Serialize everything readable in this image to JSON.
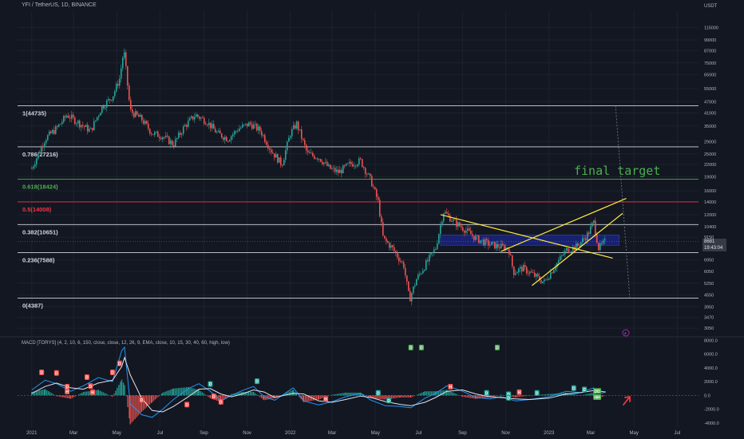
{
  "header": {
    "symbol_line": "YFI / TetherUS, 1D, BINANCE",
    "quote_currency": "USDT"
  },
  "indicator": {
    "label": "MACD [TORYS] (4, 2, 10, 6, 150, close, close, 12, 26, 9, EMA, close, 10, 15, 30, 40, 60, high, low)"
  },
  "annotation": {
    "final_target": "final target"
  },
  "live_price": {
    "price": "8681",
    "countdown": "19:43:04"
  },
  "colors": {
    "background": "#131722",
    "up": "#26a69a",
    "down": "#ef5350",
    "fib_white": "#d1d4dc",
    "fib_green": "#4caf50",
    "fib_red": "#f23645",
    "trend_yellow": "#ffeb3b",
    "zone_blue": "#1a237e",
    "macd_line": "#2196f3",
    "signal_line": "#e0e3eb"
  },
  "chart_data": [
    {
      "type": "candlestick",
      "title": "YFI / TetherUS, 1D, BINANCE",
      "y_scale": "log",
      "ylim": [
        2800,
        140000
      ],
      "y_ticks": [
        "115000",
        "99000",
        "87000",
        "75000",
        "65000",
        "55000",
        "47000",
        "41000",
        "35000",
        "29000",
        "25000",
        "22000",
        "19000",
        "16000",
        "14000",
        "12000",
        "10400",
        "9150",
        "8681",
        "6950",
        "6050",
        "5250",
        "4550",
        "3950",
        "3470",
        "3050"
      ],
      "x_ticks": [
        "2021",
        "Mar",
        "May",
        "Jul",
        "Sep",
        "Nov",
        "2022",
        "Mar",
        "May",
        "Jul",
        "Sep",
        "Nov",
        "2023",
        "Mar",
        "May",
        "Jul"
      ],
      "price_path": [
        [
          "2021-01-01",
          21000
        ],
        [
          "2021-01-20",
          30000
        ],
        [
          "2021-02-05",
          34000
        ],
        [
          "2021-02-20",
          40000
        ],
        [
          "2021-03-10",
          36000
        ],
        [
          "2021-03-25",
          33000
        ],
        [
          "2021-04-10",
          44000
        ],
        [
          "2021-04-25",
          50000
        ],
        [
          "2021-05-05",
          62000
        ],
        [
          "2021-05-11",
          88000
        ],
        [
          "2021-05-20",
          42000
        ],
        [
          "2021-06-05",
          38000
        ],
        [
          "2021-06-20",
          32000
        ],
        [
          "2021-07-05",
          31000
        ],
        [
          "2021-07-20",
          28000
        ],
        [
          "2021-08-05",
          35000
        ],
        [
          "2021-08-20",
          40000
        ],
        [
          "2021-09-05",
          37000
        ],
        [
          "2021-09-20",
          32000
        ],
        [
          "2021-10-05",
          30000
        ],
        [
          "2021-10-20",
          34000
        ],
        [
          "2021-11-05",
          36000
        ],
        [
          "2021-11-20",
          33000
        ],
        [
          "2021-12-05",
          26000
        ],
        [
          "2021-12-20",
          22000
        ],
        [
          "2022-01-01",
          32000
        ],
        [
          "2022-01-10",
          36000
        ],
        [
          "2022-01-25",
          25000
        ],
        [
          "2022-02-10",
          24000
        ],
        [
          "2022-02-25",
          21000
        ],
        [
          "2022-03-10",
          20000
        ],
        [
          "2022-03-25",
          22000
        ],
        [
          "2022-04-10",
          23000
        ],
        [
          "2022-04-25",
          18000
        ],
        [
          "2022-05-05",
          14000
        ],
        [
          "2022-05-12",
          9000
        ],
        [
          "2022-05-25",
          8000
        ],
        [
          "2022-06-10",
          6500
        ],
        [
          "2022-06-18",
          4300
        ],
        [
          "2022-06-28",
          5500
        ],
        [
          "2022-07-10",
          6500
        ],
        [
          "2022-07-25",
          8000
        ],
        [
          "2022-08-05",
          12500
        ],
        [
          "2022-08-20",
          11000
        ],
        [
          "2022-09-05",
          10000
        ],
        [
          "2022-09-20",
          9000
        ],
        [
          "2022-10-05",
          8500
        ],
        [
          "2022-10-20",
          8200
        ],
        [
          "2022-11-05",
          8000
        ],
        [
          "2022-11-12",
          6000
        ],
        [
          "2022-11-25",
          6300
        ],
        [
          "2022-12-10",
          5800
        ],
        [
          "2022-12-25",
          5300
        ],
        [
          "2023-01-10",
          6500
        ],
        [
          "2023-01-25",
          7800
        ],
        [
          "2023-02-10",
          8200
        ],
        [
          "2023-02-25",
          9500
        ],
        [
          "2023-03-05",
          11000
        ],
        [
          "2023-03-12",
          8000
        ],
        [
          "2023-03-22",
          8700
        ]
      ],
      "fib_levels": [
        {
          "label": "1(44735)",
          "value": 44735,
          "color": "#d1d4dc"
        },
        {
          "label": "0.786(27216)",
          "value": 27216,
          "color": "#d1d4dc"
        },
        {
          "label": "0.618(18424)",
          "value": 18424,
          "color": "#4caf50"
        },
        {
          "label": "0.5(14008)",
          "value": 14008,
          "color": "#f23645"
        },
        {
          "label": "0.382(10651)",
          "value": 10651,
          "color": "#d1d4dc"
        },
        {
          "label": "0.236(7588)",
          "value": 7588,
          "color": "#d1d4dc"
        },
        {
          "label": "0(4387)",
          "value": 4387,
          "color": "#d1d4dc"
        }
      ],
      "support_zone": {
        "from": "2022-08-01",
        "to": "2023-04-10",
        "low": 8300,
        "high": 9400
      },
      "trend_lines": [
        {
          "from": [
            "2022-08-01",
            12000
          ],
          "to": [
            "2023-04-01",
            7100
          ]
        },
        {
          "from": [
            "2022-12-08",
            5100
          ],
          "to": [
            "2023-04-15",
            12200
          ]
        },
        {
          "from": [
            "2022-10-25",
            7700
          ],
          "to": [
            "2023-04-20",
            14600
          ]
        }
      ],
      "projection_line": {
        "from": [
          "2023-04-05",
          44735
        ],
        "to": [
          "2023-04-25",
          4387
        ]
      },
      "price_label": "8681"
    },
    {
      "type": "line",
      "title": "MACD [TORYS] (4, 2, 10, 6, 150, close, close, 12, 26, 9, EMA, close, 10, 15, 30, 40, 60, high, low)",
      "ylim": [
        -4600,
        8400
      ],
      "y_ticks": [
        "8000.0",
        "6000.0",
        "4000.0",
        "2000.0",
        "0.0",
        "-2000.0",
        "-4000.0"
      ],
      "series": [
        {
          "values": [
            [
              "2021-01-01",
              800
            ],
            [
              "2021-01-20",
              2200
            ],
            [
              "2021-02-05",
              1700
            ],
            [
              "2021-02-25",
              600
            ],
            [
              "2021-03-15",
              1400
            ],
            [
              "2021-04-05",
              2600
            ],
            [
              "2021-04-25",
              2000
            ],
            [
              "2021-05-08",
              6500
            ],
            [
              "2021-05-12",
              7000
            ],
            [
              "2021-05-20",
              -1200
            ],
            [
              "2021-06-05",
              -2800
            ],
            [
              "2021-06-20",
              -3200
            ],
            [
              "2021-07-05",
              -2000
            ],
            [
              "2021-07-20",
              -600
            ],
            [
              "2021-08-10",
              1000
            ],
            [
              "2021-08-25",
              1700
            ],
            [
              "2021-09-10",
              600
            ],
            [
              "2021-09-25",
              -800
            ],
            [
              "2021-10-10",
              0
            ],
            [
              "2021-10-25",
              700
            ],
            [
              "2021-11-10",
              1300
            ],
            [
              "2021-11-25",
              -200
            ],
            [
              "2021-12-10",
              -700
            ],
            [
              "2022-01-05",
              1100
            ],
            [
              "2022-01-20",
              -800
            ],
            [
              "2022-02-10",
              -1400
            ],
            [
              "2022-03-01",
              -900
            ],
            [
              "2022-03-20",
              -200
            ],
            [
              "2022-04-10",
              300
            ],
            [
              "2022-04-25",
              -700
            ],
            [
              "2022-05-15",
              -1500
            ],
            [
              "2022-06-05",
              -1600
            ],
            [
              "2022-06-20",
              -1800
            ],
            [
              "2022-07-10",
              -400
            ],
            [
              "2022-07-25",
              300
            ],
            [
              "2022-08-10",
              1400
            ],
            [
              "2022-09-01",
              600
            ],
            [
              "2022-09-20",
              -300
            ],
            [
              "2022-10-10",
              -500
            ],
            [
              "2022-10-25",
              -200
            ],
            [
              "2022-11-15",
              -800
            ],
            [
              "2022-12-05",
              -600
            ],
            [
              "2023-01-01",
              -200
            ],
            [
              "2023-01-25",
              600
            ],
            [
              "2023-02-15",
              400
            ],
            [
              "2023-03-05",
              1100
            ],
            [
              "2023-03-15",
              300
            ],
            [
              "2023-03-22",
              500
            ]
          ]
        },
        {
          "values": [
            [
              "2021-01-01",
              300
            ],
            [
              "2021-01-20",
              1300
            ],
            [
              "2021-02-05",
              1800
            ],
            [
              "2021-02-25",
              1100
            ],
            [
              "2021-03-15",
              900
            ],
            [
              "2021-04-05",
              1800
            ],
            [
              "2021-04-25",
              2200
            ],
            [
              "2021-05-08",
              4200
            ],
            [
              "2021-05-12",
              5500
            ],
            [
              "2021-05-20",
              3000
            ],
            [
              "2021-06-05",
              -400
            ],
            [
              "2021-06-20",
              -2200
            ],
            [
              "2021-07-05",
              -2400
            ],
            [
              "2021-07-20",
              -1600
            ],
            [
              "2021-08-10",
              -200
            ],
            [
              "2021-08-25",
              900
            ],
            [
              "2021-09-10",
              1000
            ],
            [
              "2021-09-25",
              200
            ],
            [
              "2021-10-10",
              -200
            ],
            [
              "2021-10-25",
              200
            ],
            [
              "2021-11-10",
              800
            ],
            [
              "2021-11-25",
              500
            ],
            [
              "2021-12-10",
              -300
            ],
            [
              "2022-01-05",
              300
            ],
            [
              "2022-01-20",
              200
            ],
            [
              "2022-02-10",
              -800
            ],
            [
              "2022-03-01",
              -1000
            ],
            [
              "2022-03-20",
              -600
            ],
            [
              "2022-04-10",
              -100
            ],
            [
              "2022-04-25",
              -300
            ],
            [
              "2022-05-15",
              -900
            ],
            [
              "2022-06-05",
              -1300
            ],
            [
              "2022-06-20",
              -1500
            ],
            [
              "2022-07-10",
              -1000
            ],
            [
              "2022-07-25",
              -300
            ],
            [
              "2022-08-10",
              600
            ],
            [
              "2022-09-01",
              800
            ],
            [
              "2022-09-20",
              200
            ],
            [
              "2022-10-10",
              -200
            ],
            [
              "2022-10-25",
              -300
            ],
            [
              "2022-11-15",
              -500
            ],
            [
              "2022-12-05",
              -600
            ],
            [
              "2023-01-01",
              -400
            ],
            [
              "2023-01-25",
              200
            ],
            [
              "2023-02-15",
              400
            ],
            [
              "2023-03-05",
              700
            ],
            [
              "2023-03-15",
              600
            ],
            [
              "2023-03-22",
              500
            ]
          ]
        }
      ],
      "markers": [
        {
          "x": "2021-01-15",
          "y": 3300,
          "t": "D",
          "c": "#ef5350"
        },
        {
          "x": "2021-02-05",
          "y": 3200,
          "t": "D",
          "c": "#ef5350"
        },
        {
          "x": "2021-02-20",
          "y": 1200,
          "t": "D",
          "c": "#ef5350"
        },
        {
          "x": "2021-02-20",
          "y": 500,
          "t": "H",
          "c": "#ef5350"
        },
        {
          "x": "2021-03-20",
          "y": 2600,
          "t": "D",
          "c": "#ef5350"
        },
        {
          "x": "2021-03-25",
          "y": 1300,
          "t": "D",
          "c": "#ef5350"
        },
        {
          "x": "2021-03-28",
          "y": 400,
          "t": "H",
          "c": "#ef5350"
        },
        {
          "x": "2021-04-25",
          "y": 3300,
          "t": "D",
          "c": "#ef5350"
        },
        {
          "x": "2021-05-05",
          "y": 4600,
          "t": "D",
          "c": "#ef5350"
        },
        {
          "x": "2021-06-05",
          "y": -700,
          "t": "D",
          "c": "#ef5350"
        },
        {
          "x": "2021-08-08",
          "y": -1400,
          "t": "D",
          "c": "#ef5350"
        },
        {
          "x": "2021-09-10",
          "y": 1600,
          "t": "D",
          "c": "#26a69a"
        },
        {
          "x": "2021-09-15",
          "y": -200,
          "t": "D",
          "c": "#ef5350"
        },
        {
          "x": "2021-09-25",
          "y": -1000,
          "t": "D",
          "c": "#ef5350"
        },
        {
          "x": "2021-11-15",
          "y": 2000,
          "t": "D",
          "c": "#26a69a"
        },
        {
          "x": "2022-02-20",
          "y": -600,
          "t": "H",
          "c": "#ef5350"
        },
        {
          "x": "2022-05-05",
          "y": 300,
          "t": "D",
          "c": "#26a69a"
        },
        {
          "x": "2022-05-20",
          "y": -800,
          "t": "D",
          "c": "#26a69a"
        },
        {
          "x": "2022-06-20",
          "y": 6900,
          "t": "D",
          "c": "#4caf50"
        },
        {
          "x": "2022-07-05",
          "y": 6900,
          "t": "D",
          "c": "#4caf50"
        },
        {
          "x": "2022-08-15",
          "y": 1200,
          "t": "H",
          "c": "#ef5350"
        },
        {
          "x": "2022-10-20",
          "y": 6900,
          "t": "D",
          "c": "#4caf50"
        },
        {
          "x": "2022-10-05",
          "y": 300,
          "t": "D",
          "c": "#26a69a"
        },
        {
          "x": "2022-11-05",
          "y": 100,
          "t": "D",
          "c": "#26a69a"
        },
        {
          "x": "2022-11-05",
          "y": -400,
          "t": "D",
          "c": "#26a69a"
        },
        {
          "x": "2022-11-20",
          "y": 400,
          "t": "H",
          "c": "#ef5350"
        },
        {
          "x": "2022-12-15",
          "y": 300,
          "t": "D",
          "c": "#26a69a"
        },
        {
          "x": "2023-02-05",
          "y": 1000,
          "t": "D",
          "c": "#26a69a"
        },
        {
          "x": "2023-02-20",
          "y": 800,
          "t": "D",
          "c": "#26a69a"
        },
        {
          "x": "2023-03-10",
          "y": 600,
          "t": "DD",
          "c": "#4caf50"
        },
        {
          "x": "2023-03-10",
          "y": -300,
          "t": "HH",
          "c": "#4caf50"
        }
      ]
    }
  ]
}
